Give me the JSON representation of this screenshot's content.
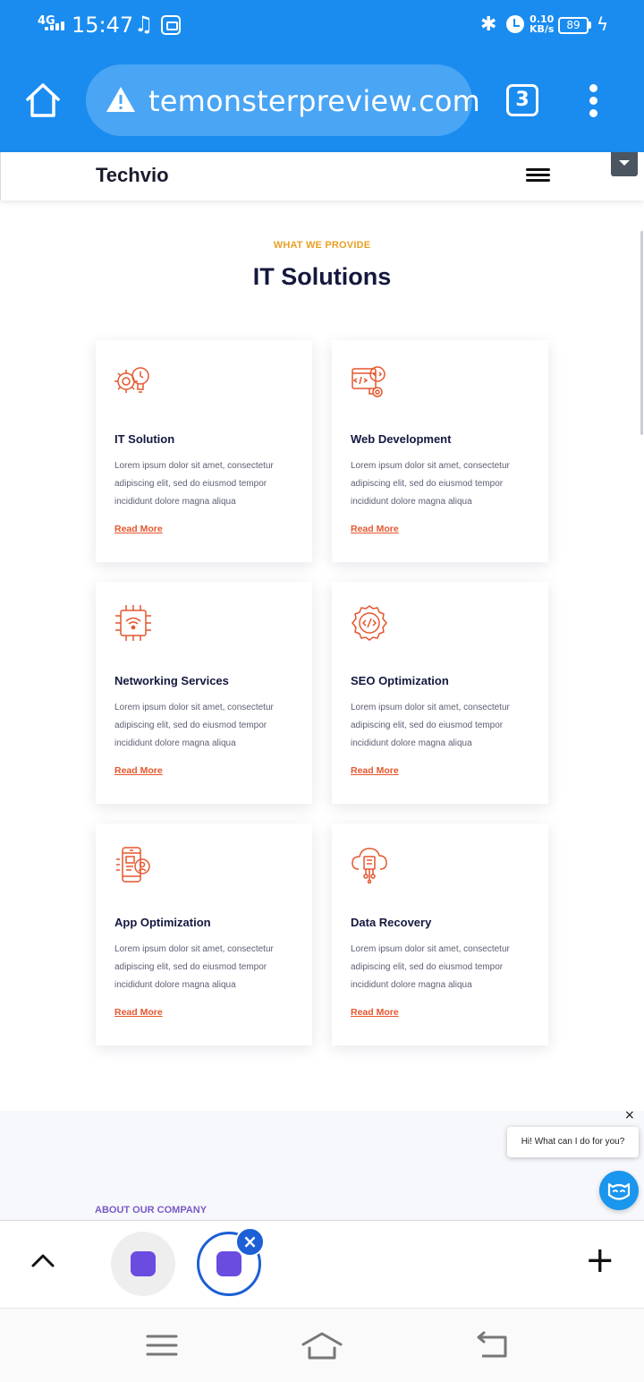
{
  "status_bar": {
    "network": "4G",
    "time": "15:47",
    "speed_value": "0.10",
    "speed_unit": "KB/s",
    "battery": "89"
  },
  "browser": {
    "url": "temonsterpreview.com",
    "tab_count": "3",
    "icons": [
      "home-icon",
      "warning-icon",
      "tabs-icon",
      "more-vertical-icon"
    ]
  },
  "site": {
    "logo": "Techvio",
    "menu_icon": "hamburger-icon"
  },
  "section": {
    "eyebrow": "WHAT WE PROVIDE",
    "title": "IT Solutions",
    "cards": [
      {
        "title": "IT Solution",
        "description": "Lorem ipsum dolor sit amet, consectetur adipiscing elit, sed do eiusmod tempor incididunt dolore magna aliqua",
        "link": "Read More",
        "icon": "gear-bulb-icon"
      },
      {
        "title": "Web Development",
        "description": "Lorem ipsum dolor sit amet, consectetur adipiscing elit, sed do eiusmod tempor incididunt dolore magna aliqua",
        "link": "Read More",
        "icon": "code-gear-icon"
      },
      {
        "title": "Networking Services",
        "description": "Lorem ipsum dolor sit amet, consectetur adipiscing elit, sed do eiusmod tempor incididunt dolore magna aliqua",
        "link": "Read More",
        "icon": "wifi-chip-icon"
      },
      {
        "title": "SEO Optimization",
        "description": "Lorem ipsum dolor sit amet, consectetur adipiscing elit, sed do eiusmod tempor incididunt dolore magna aliqua",
        "link": "Read More",
        "icon": "code-cog-icon"
      },
      {
        "title": "App Optimization",
        "description": "Lorem ipsum dolor sit amet, consectetur adipiscing elit, sed do eiusmod tempor incididunt dolore magna aliqua",
        "link": "Read More",
        "icon": "mobile-user-icon"
      },
      {
        "title": "Data Recovery",
        "description": "Lorem ipsum dolor sit amet, consectetur adipiscing elit, sed do eiusmod tempor incididunt dolore magna aliqua",
        "link": "Read More",
        "icon": "cloud-circuit-icon"
      }
    ]
  },
  "about": {
    "eyebrow": "ABOUT OUR COMPANY"
  },
  "chat": {
    "greeting": "Hi! What can I do for you?",
    "close": "×"
  },
  "tab_strip": {
    "close": "×",
    "add": "+"
  },
  "colors": {
    "browser_blue": "#1a8cf0",
    "accent_orange": "#e4572e",
    "eyebrow_gold": "#e8a025",
    "heading_navy": "#14183e",
    "about_purple": "#7a5ac7"
  }
}
